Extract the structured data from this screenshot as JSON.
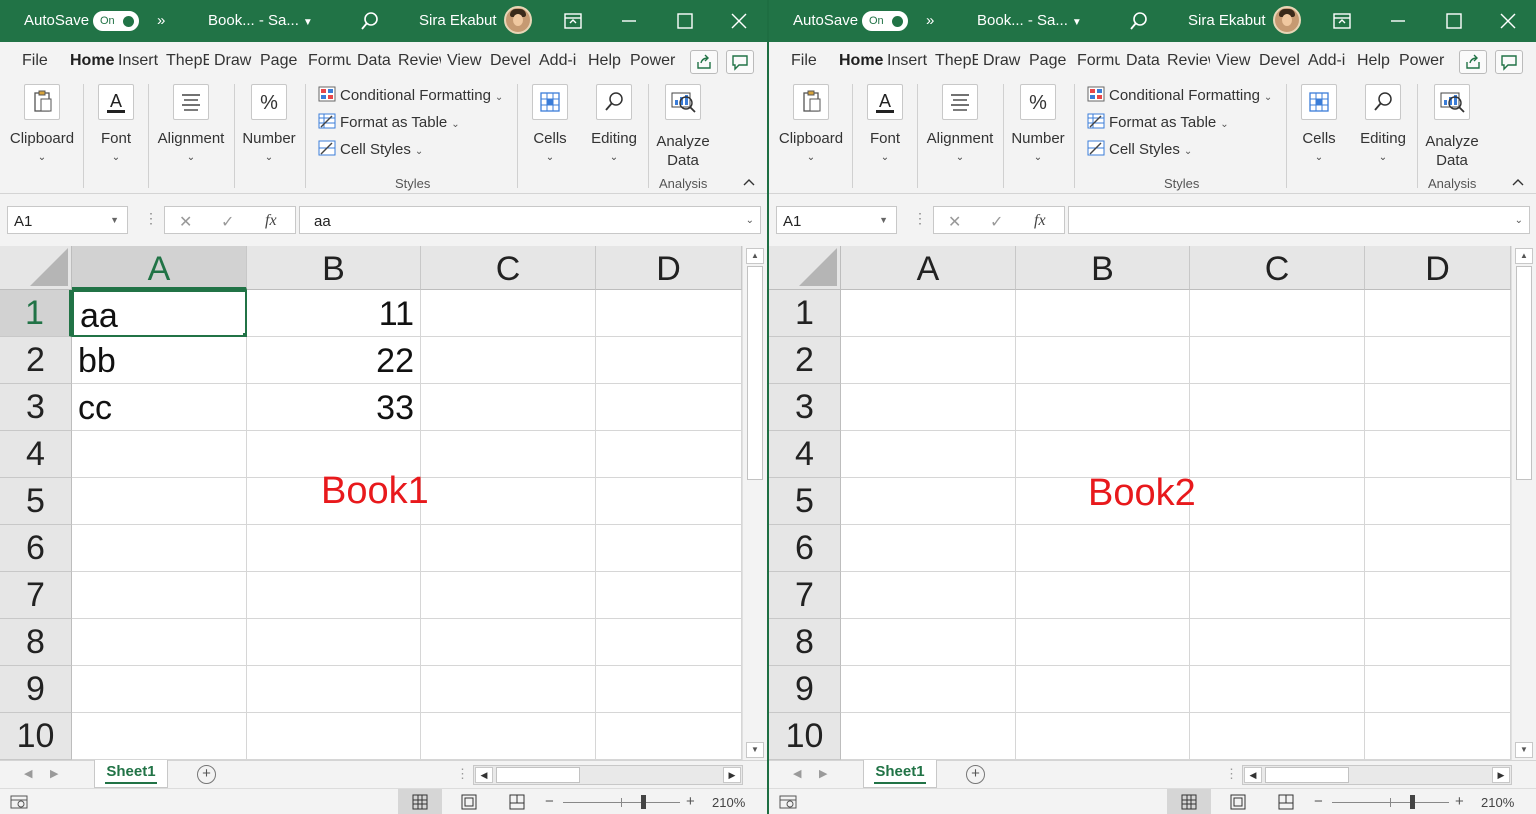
{
  "windows": [
    {
      "autosave_label": "AutoSave",
      "toggle_label": "On",
      "overflow_label": "»",
      "doc_title": "Book... - Sa...",
      "user_name": "Sira Ekabut",
      "menu_tabs": [
        "File",
        "Home",
        "Insert",
        "ThepE",
        "Draw",
        "Page L",
        "Formu",
        "Data",
        "Review",
        "View",
        "Devel",
        "Add-i",
        "Help",
        "Power"
      ],
      "ribbon": {
        "clipboard": "Clipboard",
        "font": "Font",
        "alignment": "Alignment",
        "number": "Number",
        "conditional_formatting": "Conditional Formatting",
        "format_as_table": "Format as Table",
        "cell_styles": "Cell Styles",
        "styles_group": "Styles",
        "cells": "Cells",
        "editing": "Editing",
        "analyze_line1": "Analyze",
        "analyze_line2": "Data",
        "analysis_group": "Analysis"
      },
      "name_box": "A1",
      "formula_value": "aa",
      "columns": [
        "A",
        "B",
        "C",
        "D"
      ],
      "rows": [
        "1",
        "2",
        "3",
        "4",
        "5",
        "6",
        "7",
        "8",
        "9",
        "10"
      ],
      "cells": {
        "A1": "aa",
        "A2": "bb",
        "A3": "cc",
        "B1": "11",
        "B2": "22",
        "B3": "33"
      },
      "overlay_label": "Book1",
      "sheet_tab": "Sheet1",
      "zoom": "210%"
    },
    {
      "autosave_label": "AutoSave",
      "toggle_label": "On",
      "overflow_label": "»",
      "doc_title": "Book... - Sa...",
      "user_name": "Sira Ekabut",
      "menu_tabs": [
        "File",
        "Home",
        "Insert",
        "ThepE",
        "Draw",
        "Page L",
        "Formu",
        "Data",
        "Review",
        "View",
        "Devel",
        "Add-i",
        "Help",
        "Power"
      ],
      "ribbon": {
        "clipboard": "Clipboard",
        "font": "Font",
        "alignment": "Alignment",
        "number": "Number",
        "conditional_formatting": "Conditional Formatting",
        "format_as_table": "Format as Table",
        "cell_styles": "Cell Styles",
        "styles_group": "Styles",
        "cells": "Cells",
        "editing": "Editing",
        "analyze_line1": "Analyze",
        "analyze_line2": "Data",
        "analysis_group": "Analysis"
      },
      "name_box": "A1",
      "formula_value": "",
      "columns": [
        "A",
        "B",
        "C",
        "D"
      ],
      "rows": [
        "1",
        "2",
        "3",
        "4",
        "5",
        "6",
        "7",
        "8",
        "9",
        "10"
      ],
      "cells": {},
      "overlay_label": "Book2",
      "sheet_tab": "Sheet1",
      "zoom": "210%"
    }
  ],
  "colors": {
    "excel_green": "#217346",
    "overlay_red": "#e8191c",
    "ribbon_bg": "#f3f3f3"
  }
}
